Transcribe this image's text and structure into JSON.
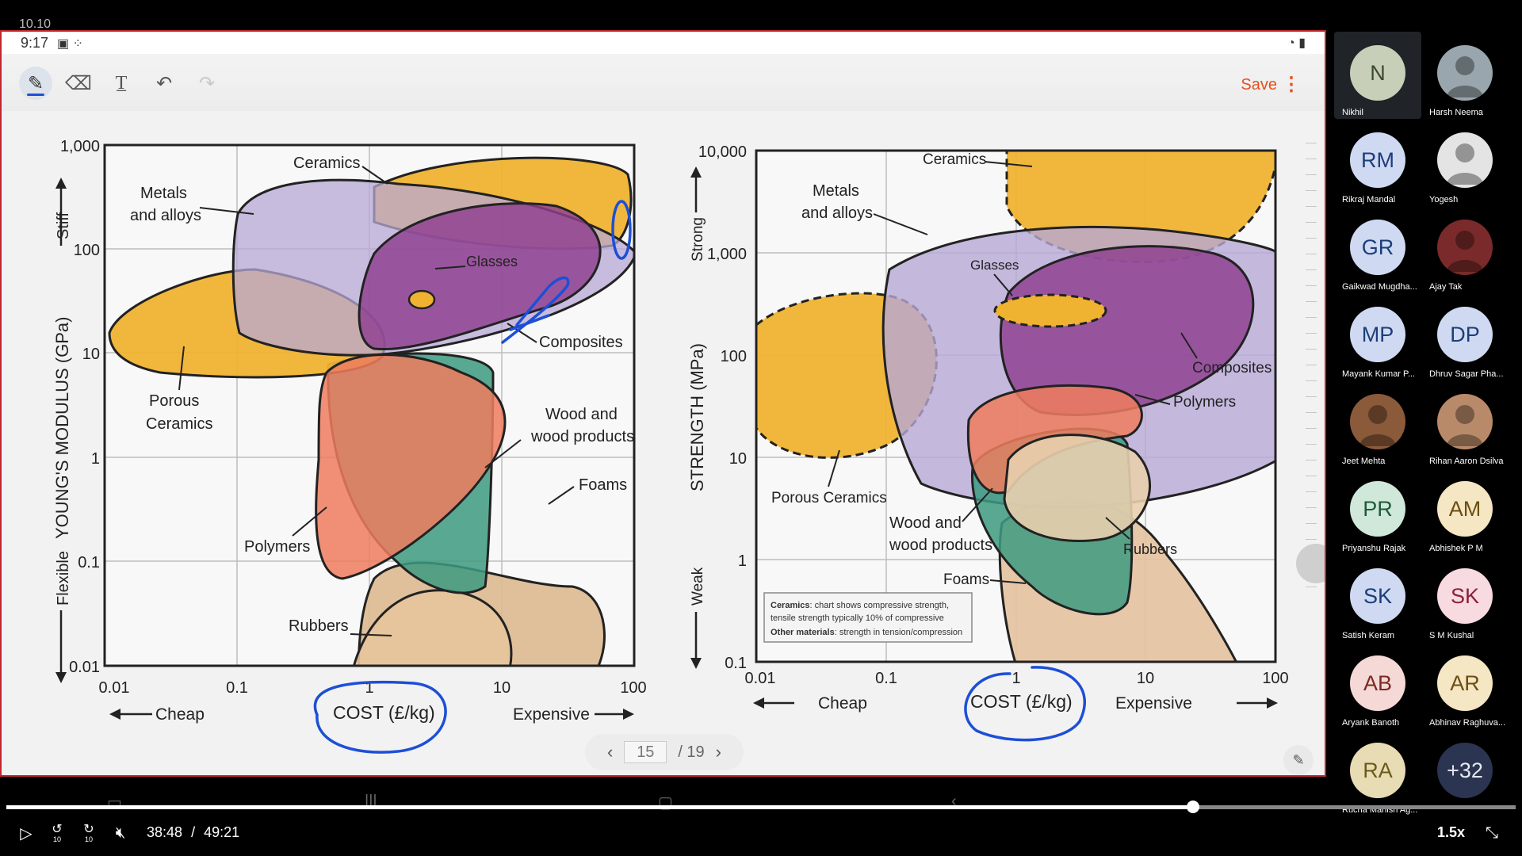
{
  "overlay": {
    "corner_number": "10.10"
  },
  "status_bar": {
    "time": "9:17"
  },
  "toolbar": {
    "save_label": "Save"
  },
  "slide": {
    "left_chart": {
      "y_axis_label": "YOUNG'S MODULUS (GPa)",
      "y_ticks": [
        "1,000",
        "100",
        "10",
        "1",
        "0.1",
        "0.01"
      ],
      "y_top_label": "Stiff",
      "y_bottom_label": "Flexible",
      "x_ticks": [
        "0.01",
        "0.1",
        "1",
        "10",
        "100"
      ],
      "x_axis_label": "COST (£/kg)",
      "x_left_label": "Cheap",
      "x_right_label": "Expensive",
      "labels": {
        "ceramics": "Ceramics",
        "metals_1": "Metals",
        "metals_2": "and alloys",
        "glasses": "Glasses",
        "composites": "Composites",
        "porous_1": "Porous",
        "porous_2": "Ceramics",
        "wood_1": "Wood and",
        "wood_2": "wood products",
        "foams": "Foams",
        "polymers": "Polymers",
        "rubbers": "Rubbers"
      }
    },
    "right_chart": {
      "y_axis_label": "STRENGTH (MPa)",
      "y_ticks": [
        "10,000",
        "1,000",
        "100",
        "10",
        "1",
        "0.1"
      ],
      "y_top_label": "Strong",
      "y_bottom_label": "Weak",
      "x_ticks": [
        "0.01",
        "0.1",
        "1",
        "10",
        "100"
      ],
      "x_axis_label": "COST (£/kg)",
      "x_left_label": "Cheap",
      "x_right_label": "Expensive",
      "labels": {
        "ceramics": "Ceramics",
        "metals_1": "Metals",
        "metals_2": "and alloys",
        "glasses": "Glasses",
        "composites": "Composites",
        "polymers": "Polymers",
        "porous": "Porous Ceramics",
        "wood_1": "Wood and",
        "wood_2": "wood products",
        "rubbers": "Rubbers",
        "foams": "Foams"
      },
      "note": {
        "line1_bold": "Ceramics",
        "line1_rest": ": chart shows compressive strength,",
        "line2": "tensile strength typically 10% of compressive",
        "line3_bold": "Other materials",
        "line3_rest": ": strength in tension/compression"
      }
    }
  },
  "pager": {
    "current_page": "15",
    "total": "/ 19"
  },
  "participants": [
    {
      "initials": "N",
      "name": "Nikhil",
      "bg": "#c8cfb8",
      "fg": "#394a2c",
      "photo": false,
      "selected": true
    },
    {
      "initials": "",
      "name": "Harsh Neema",
      "bg": "#9aa6ad",
      "fg": "#fff",
      "photo": true,
      "selected": false
    },
    {
      "initials": "RM",
      "name": "Rikraj Mandal",
      "bg": "#cfdaf2",
      "fg": "#1c3d7a",
      "photo": false,
      "selected": false
    },
    {
      "initials": "",
      "name": "Yogesh",
      "bg": "#e4e4e4",
      "fg": "#333",
      "photo": true,
      "selected": false
    },
    {
      "initials": "GR",
      "name": "Gaikwad Mugdha...",
      "bg": "#cfdaf2",
      "fg": "#1c3d7a",
      "photo": false,
      "selected": false
    },
    {
      "initials": "",
      "name": "Ajay Tak",
      "bg": "#7a2a2a",
      "fg": "#fff",
      "photo": true,
      "selected": false
    },
    {
      "initials": "MP",
      "name": "Mayank Kumar P...",
      "bg": "#cfdaf2",
      "fg": "#1c3d7a",
      "photo": false,
      "selected": false
    },
    {
      "initials": "DP",
      "name": "Dhruv Sagar Pha...",
      "bg": "#cfdaf2",
      "fg": "#1c3d7a",
      "photo": false,
      "selected": false
    },
    {
      "initials": "",
      "name": "Jeet Mehta",
      "bg": "#8a5a3a",
      "fg": "#fff",
      "photo": true,
      "selected": false
    },
    {
      "initials": "",
      "name": "Rihan Aaron Dsilva",
      "bg": "#b98a6a",
      "fg": "#fff",
      "photo": true,
      "selected": false
    },
    {
      "initials": "PR",
      "name": "Priyanshu Rajak",
      "bg": "#cfe8d9",
      "fg": "#1f5a3b",
      "photo": false,
      "selected": false
    },
    {
      "initials": "AM",
      "name": "Abhishek P M",
      "bg": "#f5e6c4",
      "fg": "#6b4f12",
      "photo": false,
      "selected": false
    },
    {
      "initials": "SK",
      "name": "Satish Keram",
      "bg": "#cfdaf2",
      "fg": "#1c3d7a",
      "photo": false,
      "selected": false
    },
    {
      "initials": "SK",
      "name": "S M Kushal",
      "bg": "#f8dbe0",
      "fg": "#8a2237",
      "photo": false,
      "selected": false
    },
    {
      "initials": "AB",
      "name": "Aryank Banoth",
      "bg": "#f4d9d6",
      "fg": "#7d2a22",
      "photo": false,
      "selected": false
    },
    {
      "initials": "AR",
      "name": "Abhinav Raghuva...",
      "bg": "#f5e6c4",
      "fg": "#6b4f12",
      "photo": false,
      "selected": false
    },
    {
      "initials": "RA",
      "name": "Rucha Manish Ag...",
      "bg": "#e8dcb5",
      "fg": "#6b5a1a",
      "photo": false,
      "selected": false
    },
    {
      "initials": "+32",
      "name": "",
      "bg": "#2b3450",
      "fg": "#e6e9f2",
      "photo": false,
      "selected": false
    }
  ],
  "video": {
    "current_time": "38:48",
    "separator": "/",
    "duration": "49:21",
    "progress_fraction": 0.786,
    "speed": "1.5x",
    "skip_back": "10",
    "skip_forward": "10"
  }
}
